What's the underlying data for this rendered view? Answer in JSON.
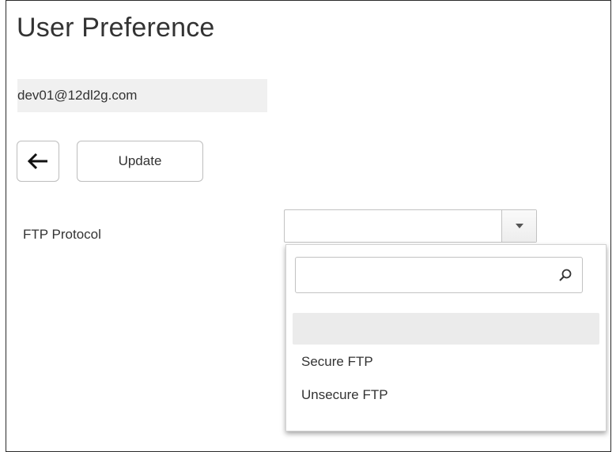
{
  "page": {
    "title": "User Preference"
  },
  "user": {
    "email": "dev01@12dl2g.com"
  },
  "toolbar": {
    "back_icon": "arrow-left-icon",
    "update_label": "Update"
  },
  "ftp": {
    "label": "FTP Protocol",
    "selected_value": "",
    "dropdown_open": true,
    "search_value": "",
    "search_icon": "search-icon",
    "options": [
      {
        "label": "",
        "highlighted": true
      },
      {
        "label": "Secure FTP",
        "highlighted": false
      },
      {
        "label": "Unsecure FTP",
        "highlighted": false
      }
    ]
  }
}
